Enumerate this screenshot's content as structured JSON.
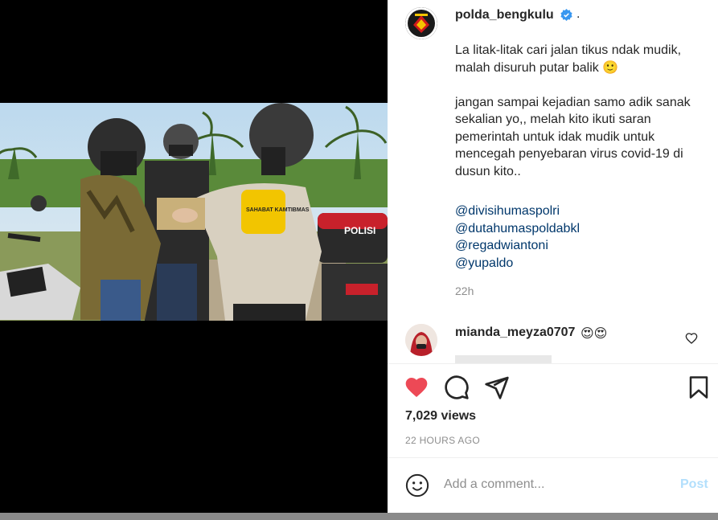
{
  "post": {
    "username": "polda_bengkulu",
    "separator": ".",
    "caption": "La litak-litak cari jalan tikus ndak mudik, malah disuruh putar balik 🙂\n\njangan sampai kejadian samo adik sanak sekalian yo,, melah kito ikuti saran pemerintah untuk idak mudik untuk mencegah penyebaran virus covid-19 di dusun kito..",
    "mentions": [
      "@divisihumaspolri",
      "@dutahumaspoldabkl",
      "@regadwiantoni",
      "@yupaldo"
    ],
    "time_ago": "22h"
  },
  "comment": {
    "username": "mianda_meyza0707",
    "text": "😍😍"
  },
  "actions": {
    "icons": [
      "heart-icon",
      "comment-icon",
      "share-icon",
      "bookmark-icon"
    ],
    "liked": true,
    "like_color": "#ed4956"
  },
  "stats": {
    "views": "7,029 views",
    "timestamp": "22 HOURS AGO"
  },
  "add_comment": {
    "placeholder": "Add a comment...",
    "post_label": "Post"
  },
  "media": {
    "van_text": "POLISI",
    "armband_text": "SAHABAT KAMTIBMAS"
  }
}
